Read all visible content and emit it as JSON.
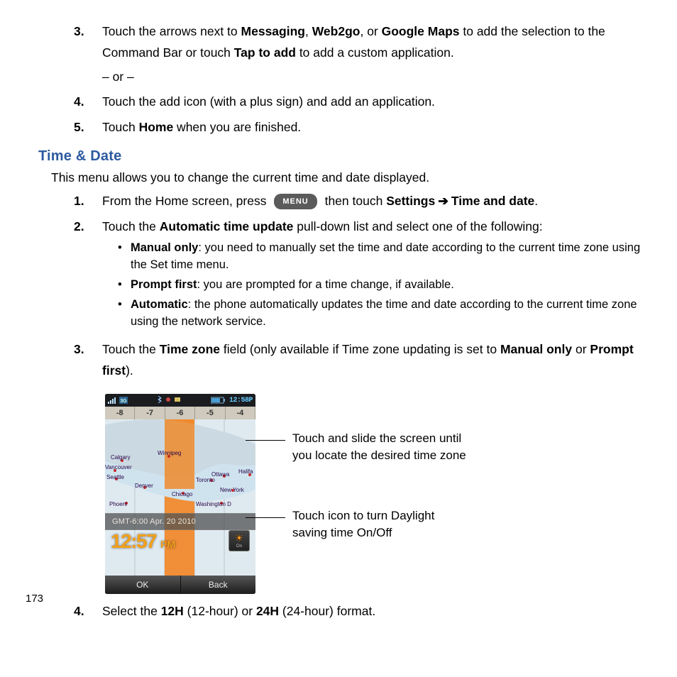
{
  "steps_first_block": {
    "s3": {
      "num": "3.",
      "pre": "Touch the arrows next to ",
      "b1": "Messaging",
      "sep1": ", ",
      "b2": "Web2go",
      "sep2": ", or ",
      "b3": "Google Maps",
      "mid": " to add the selection to the Command Bar or touch ",
      "b4": "Tap to add",
      "post": " to add a custom application.",
      "or": "– or –"
    },
    "s4": {
      "num": "4.",
      "text": "Touch the add icon (with a plus sign) and add an application."
    },
    "s5": {
      "num": "5.",
      "pre": "Touch ",
      "b1": "Home",
      "post": " when you are finished."
    }
  },
  "heading": "Time & Date",
  "lead": "This menu allows you to change the current time and date displayed.",
  "steps_second_block": {
    "s1": {
      "num": "1.",
      "pre": "From the Home screen, press ",
      "menu_label": "MENU",
      "mid": " then touch ",
      "b1": "Settings",
      "arrow": "➔",
      "b2": "Time and date",
      "post": "."
    },
    "s2": {
      "num": "2.",
      "pre": "Touch the ",
      "b1": "Automatic time update",
      "post": " pull-down list and select one of the following:"
    },
    "bullets": {
      "b1_label": "Manual only",
      "b1_text": ": you need to manually set the time and date according to the current time zone using the Set time menu.",
      "b2_label": "Prompt first",
      "b2_text": ": you are prompted for a time change, if available.",
      "b3_label": "Automatic",
      "b3_text": ": the phone automatically updates the time and date according to the current time zone using the network service."
    },
    "s3": {
      "num": "3.",
      "pre": "Touch the ",
      "b1": "Time zone",
      "mid": " field (only available if Time zone updating is set to ",
      "b2": "Manual only",
      "sep": " or ",
      "b3": "Prompt first",
      "post": ")."
    },
    "s4": {
      "num": "4.",
      "pre": "Select the ",
      "b1": "12H",
      "mid": " (12-hour) or ",
      "b2": "24H",
      "post": " (24-hour) format."
    }
  },
  "phone": {
    "statusbar_time": "12:58P",
    "tz_marks": [
      "-8",
      "-7",
      "-6",
      "-5",
      "-4"
    ],
    "cities": {
      "calgary": "Calgary",
      "vancouver": "Vancouver",
      "seattle": "Seattle",
      "winnipeg": "Winnipeg",
      "denver": "Denver",
      "chicago": "Chicago",
      "toronto": "Toronto",
      "ottawa": "Ottawa",
      "halifax": "Halifa",
      "newyork": "New York",
      "phoenix": "Phoeni",
      "washington": "Washington D"
    },
    "gmt_strip": "GMT-6:00 Apr. 20 2010",
    "time_big": "12:57",
    "time_ampm": "PM",
    "dst_on": "On",
    "sk_ok": "OK",
    "sk_back": "Back"
  },
  "callouts": {
    "c1_l1": "Touch and slide the screen until",
    "c1_l2": "you locate the desired time zone",
    "c2_l1": "Touch icon to turn Daylight",
    "c2_l2": "saving time On/Off"
  },
  "page_number": "173"
}
